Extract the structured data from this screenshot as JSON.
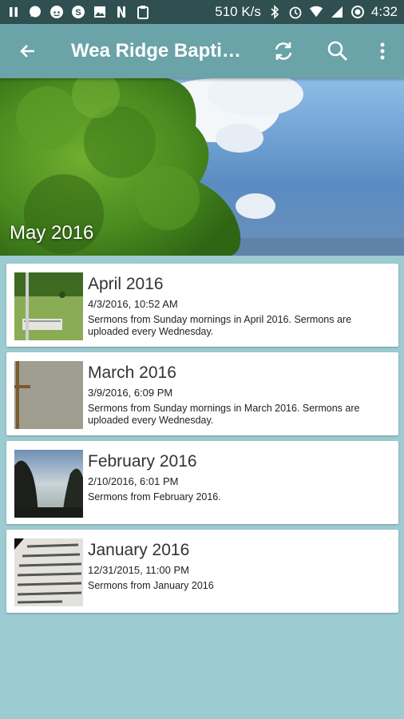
{
  "status_bar": {
    "net_speed": "510 K/s",
    "time": "4:32"
  },
  "app_bar": {
    "title": "Wea Ridge Baptist…",
    "icons": [
      "back-arrow-icon",
      "refresh-icon",
      "search-icon",
      "overflow-menu-icon"
    ]
  },
  "hero": {
    "title": "May 2016"
  },
  "items": [
    {
      "title": "April 2016",
      "date": "4/3/2016, 10:52 AM",
      "description": "Sermons from Sunday mornings in April 2016. Sermons are uploaded every Wednesday."
    },
    {
      "title": "March 2016",
      "date": "3/9/2016, 6:09 PM",
      "description": "Sermons from Sunday mornings in March 2016. Sermons are uploaded every Wednesday."
    },
    {
      "title": "February 2016",
      "date": "2/10/2016, 6:01 PM",
      "description": "Sermons from February 2016."
    },
    {
      "title": "January 2016",
      "date": "12/31/2015, 11:00 PM",
      "description": "Sermons from January 2016"
    }
  ],
  "colors": {
    "status_bar": "#2f4f50",
    "app_bar": "#6aa3a8",
    "background": "#9ccbd1"
  }
}
